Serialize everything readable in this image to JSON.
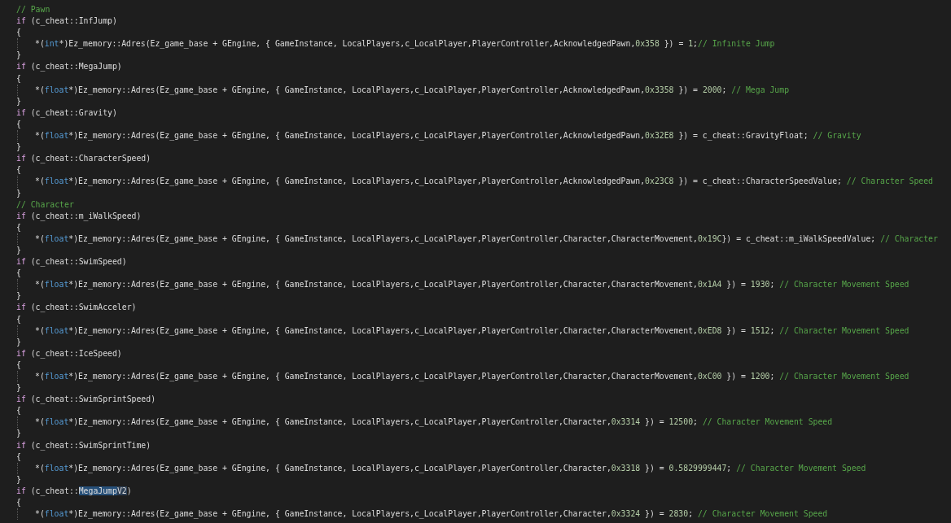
{
  "editor": {
    "lines": [
      {
        "kind": "comment",
        "tokens": [
          {
            "text": "// Pawn",
            "kind": "comment"
          }
        ]
      },
      {
        "kind": "if",
        "tokens": [
          {
            "text": "if",
            "kind": "control"
          },
          {
            "text": " (c_cheat::InfJump)",
            "kind": "plain"
          }
        ]
      },
      {
        "kind": "brace",
        "tokens": [
          {
            "text": "{",
            "kind": "plain"
          }
        ]
      },
      {
        "kind": "statement",
        "tokens": [
          {
            "text": "*(",
            "kind": "plain"
          },
          {
            "text": "int",
            "kind": "keyword"
          },
          {
            "text": "*)Ez_memory::Adres(Ez_game_base + GEngine, { GameInstance, LocalPlayers,c_LocalPlayer,PlayerController,AcknowledgedPawn,",
            "kind": "plain"
          },
          {
            "text": "0x358",
            "kind": "number"
          },
          {
            "text": " }) = ",
            "kind": "plain"
          },
          {
            "text": "1",
            "kind": "number"
          },
          {
            "text": ";",
            "kind": "plain"
          },
          {
            "text": "// Infınite Jump",
            "kind": "comment"
          }
        ]
      },
      {
        "kind": "brace",
        "tokens": [
          {
            "text": "}",
            "kind": "plain"
          }
        ]
      },
      {
        "kind": "if",
        "tokens": [
          {
            "text": "if",
            "kind": "control"
          },
          {
            "text": " (c_cheat::MegaJump)",
            "kind": "plain"
          }
        ]
      },
      {
        "kind": "brace",
        "tokens": [
          {
            "text": "{",
            "kind": "plain"
          }
        ]
      },
      {
        "kind": "statement",
        "tokens": [
          {
            "text": "*(",
            "kind": "plain"
          },
          {
            "text": "float",
            "kind": "keyword"
          },
          {
            "text": "*)Ez_memory::Adres(Ez_game_base + GEngine, { GameInstance, LocalPlayers,c_LocalPlayer,PlayerController,AcknowledgedPawn,",
            "kind": "plain"
          },
          {
            "text": "0x3358",
            "kind": "number"
          },
          {
            "text": " }) = ",
            "kind": "plain"
          },
          {
            "text": "2000",
            "kind": "number"
          },
          {
            "text": "; ",
            "kind": "plain"
          },
          {
            "text": "// Mega Jump",
            "kind": "comment"
          }
        ]
      },
      {
        "kind": "brace",
        "tokens": [
          {
            "text": "}",
            "kind": "plain"
          }
        ]
      },
      {
        "kind": "if",
        "tokens": [
          {
            "text": "if",
            "kind": "control"
          },
          {
            "text": " (c_cheat::Gravity)",
            "kind": "plain"
          }
        ]
      },
      {
        "kind": "brace",
        "tokens": [
          {
            "text": "{",
            "kind": "plain"
          }
        ]
      },
      {
        "kind": "statement",
        "tokens": [
          {
            "text": "*(",
            "kind": "plain"
          },
          {
            "text": "float",
            "kind": "keyword"
          },
          {
            "text": "*)Ez_memory::Adres(Ez_game_base + GEngine, { GameInstance, LocalPlayers,c_LocalPlayer,PlayerController,AcknowledgedPawn,",
            "kind": "plain"
          },
          {
            "text": "0x32E8",
            "kind": "number"
          },
          {
            "text": " }) = c_cheat::GravityFloat; ",
            "kind": "plain"
          },
          {
            "text": "// Gravity",
            "kind": "comment"
          }
        ]
      },
      {
        "kind": "brace",
        "tokens": [
          {
            "text": "}",
            "kind": "plain"
          }
        ]
      },
      {
        "kind": "if",
        "tokens": [
          {
            "text": "if",
            "kind": "control"
          },
          {
            "text": " (c_cheat::CharacterSpeed)",
            "kind": "plain"
          }
        ]
      },
      {
        "kind": "brace",
        "tokens": [
          {
            "text": "{",
            "kind": "plain"
          }
        ]
      },
      {
        "kind": "statement",
        "tokens": [
          {
            "text": "*(",
            "kind": "plain"
          },
          {
            "text": "float",
            "kind": "keyword"
          },
          {
            "text": "*)Ez_memory::Adres(Ez_game_base + GEngine, { GameInstance, LocalPlayers,c_LocalPlayer,PlayerController,AcknowledgedPawn,",
            "kind": "plain"
          },
          {
            "text": "0x23C8",
            "kind": "number"
          },
          {
            "text": " }) = c_cheat::CharacterSpeedValue; ",
            "kind": "plain"
          },
          {
            "text": "// Character Speed",
            "kind": "comment"
          }
        ]
      },
      {
        "kind": "brace",
        "tokens": [
          {
            "text": "}",
            "kind": "plain"
          }
        ]
      },
      {
        "kind": "comment",
        "tokens": [
          {
            "text": "// Character",
            "kind": "comment"
          }
        ]
      },
      {
        "kind": "if",
        "tokens": [
          {
            "text": "if",
            "kind": "control"
          },
          {
            "text": " (c_cheat::m_iWalkSpeed)",
            "kind": "plain"
          }
        ]
      },
      {
        "kind": "brace",
        "tokens": [
          {
            "text": "{",
            "kind": "plain"
          }
        ]
      },
      {
        "kind": "statement",
        "tokens": [
          {
            "text": "*(",
            "kind": "plain"
          },
          {
            "text": "float",
            "kind": "keyword"
          },
          {
            "text": "*)Ez_memory::Adres(Ez_game_base + GEngine, { GameInstance, LocalPlayers,c_LocalPlayer,PlayerController,Character,CharacterMovement,",
            "kind": "plain"
          },
          {
            "text": "0x19C",
            "kind": "number"
          },
          {
            "text": "}) = c_cheat::m_iWalkSpeedValue; ",
            "kind": "plain"
          },
          {
            "text": "// Character",
            "kind": "comment"
          }
        ]
      },
      {
        "kind": "brace",
        "tokens": [
          {
            "text": "}",
            "kind": "plain"
          }
        ]
      },
      {
        "kind": "if",
        "tokens": [
          {
            "text": "if",
            "kind": "control"
          },
          {
            "text": " (c_cheat::SwimSpeed)",
            "kind": "plain"
          }
        ]
      },
      {
        "kind": "brace",
        "tokens": [
          {
            "text": "{",
            "kind": "plain"
          }
        ]
      },
      {
        "kind": "statement",
        "tokens": [
          {
            "text": "*(",
            "kind": "plain"
          },
          {
            "text": "float",
            "kind": "keyword"
          },
          {
            "text": "*)Ez_memory::Adres(Ez_game_base + GEngine, { GameInstance, LocalPlayers,c_LocalPlayer,PlayerController,Character,CharacterMovement,",
            "kind": "plain"
          },
          {
            "text": "0x1A4",
            "kind": "number"
          },
          {
            "text": " }) = ",
            "kind": "plain"
          },
          {
            "text": "1930",
            "kind": "number"
          },
          {
            "text": "; ",
            "kind": "plain"
          },
          {
            "text": "// Character Movement Speed",
            "kind": "comment"
          }
        ]
      },
      {
        "kind": "brace",
        "tokens": [
          {
            "text": "}",
            "kind": "plain"
          }
        ]
      },
      {
        "kind": "if",
        "tokens": [
          {
            "text": "if",
            "kind": "control"
          },
          {
            "text": " (c_cheat::SwimAcceler)",
            "kind": "plain"
          }
        ]
      },
      {
        "kind": "brace",
        "tokens": [
          {
            "text": "{",
            "kind": "plain"
          }
        ]
      },
      {
        "kind": "statement",
        "tokens": [
          {
            "text": "*(",
            "kind": "plain"
          },
          {
            "text": "float",
            "kind": "keyword"
          },
          {
            "text": "*)Ez_memory::Adres(Ez_game_base + GEngine, { GameInstance, LocalPlayers,c_LocalPlayer,PlayerController,Character,CharacterMovement,",
            "kind": "plain"
          },
          {
            "text": "0xED8",
            "kind": "number"
          },
          {
            "text": " }) = ",
            "kind": "plain"
          },
          {
            "text": "1512",
            "kind": "number"
          },
          {
            "text": "; ",
            "kind": "plain"
          },
          {
            "text": "// Character Movement Speed",
            "kind": "comment"
          }
        ]
      },
      {
        "kind": "brace",
        "tokens": [
          {
            "text": "}",
            "kind": "plain"
          }
        ]
      },
      {
        "kind": "if",
        "tokens": [
          {
            "text": "if",
            "kind": "control"
          },
          {
            "text": " (c_cheat::IceSpeed)",
            "kind": "plain"
          }
        ]
      },
      {
        "kind": "brace",
        "tokens": [
          {
            "text": "{",
            "kind": "plain"
          }
        ]
      },
      {
        "kind": "statement",
        "tokens": [
          {
            "text": "*(",
            "kind": "plain"
          },
          {
            "text": "float",
            "kind": "keyword"
          },
          {
            "text": "*)Ez_memory::Adres(Ez_game_base + GEngine, { GameInstance, LocalPlayers,c_LocalPlayer,PlayerController,Character,CharacterMovement,",
            "kind": "plain"
          },
          {
            "text": "0xC00",
            "kind": "number"
          },
          {
            "text": " }) = ",
            "kind": "plain"
          },
          {
            "text": "1200",
            "kind": "number"
          },
          {
            "text": "; ",
            "kind": "plain"
          },
          {
            "text": "// Character Movement Speed",
            "kind": "comment"
          }
        ]
      },
      {
        "kind": "brace",
        "tokens": [
          {
            "text": "}",
            "kind": "plain"
          }
        ]
      },
      {
        "kind": "if",
        "tokens": [
          {
            "text": "if",
            "kind": "control"
          },
          {
            "text": " (c_cheat::SwimSprintSpeed)",
            "kind": "plain"
          }
        ]
      },
      {
        "kind": "brace",
        "tokens": [
          {
            "text": "{",
            "kind": "plain"
          }
        ]
      },
      {
        "kind": "statement",
        "tokens": [
          {
            "text": "*(",
            "kind": "plain"
          },
          {
            "text": "float",
            "kind": "keyword"
          },
          {
            "text": "*)Ez_memory::Adres(Ez_game_base + GEngine, { GameInstance, LocalPlayers,c_LocalPlayer,PlayerController,Character,",
            "kind": "plain"
          },
          {
            "text": "0x3314",
            "kind": "number"
          },
          {
            "text": " }) = ",
            "kind": "plain"
          },
          {
            "text": "12500",
            "kind": "number"
          },
          {
            "text": "; ",
            "kind": "plain"
          },
          {
            "text": "// Character Movement Speed",
            "kind": "comment"
          }
        ]
      },
      {
        "kind": "brace",
        "tokens": [
          {
            "text": "}",
            "kind": "plain"
          }
        ]
      },
      {
        "kind": "if",
        "tokens": [
          {
            "text": "if",
            "kind": "control"
          },
          {
            "text": " (c_cheat::SwimSprintTime)",
            "kind": "plain"
          }
        ]
      },
      {
        "kind": "brace",
        "tokens": [
          {
            "text": "{",
            "kind": "plain"
          }
        ]
      },
      {
        "kind": "statement",
        "tokens": [
          {
            "text": "*(",
            "kind": "plain"
          },
          {
            "text": "float",
            "kind": "keyword"
          },
          {
            "text": "*)Ez_memory::Adres(Ez_game_base + GEngine, { GameInstance, LocalPlayers,c_LocalPlayer,PlayerController,Character,",
            "kind": "plain"
          },
          {
            "text": "0x3318",
            "kind": "number"
          },
          {
            "text": " }) = ",
            "kind": "plain"
          },
          {
            "text": "0.5829999447",
            "kind": "number"
          },
          {
            "text": "; ",
            "kind": "plain"
          },
          {
            "text": "// Character Movement Speed",
            "kind": "comment"
          }
        ]
      },
      {
        "kind": "brace",
        "tokens": [
          {
            "text": "}",
            "kind": "plain"
          }
        ]
      },
      {
        "kind": "if",
        "tokens": [
          {
            "text": "if",
            "kind": "control"
          },
          {
            "text": " (c_cheat::",
            "kind": "plain"
          },
          {
            "text": "MegaJump",
            "kind": "plain",
            "selected": true
          },
          {
            "text": "V2",
            "kind": "plain",
            "matched": true
          },
          {
            "text": ")",
            "kind": "plain"
          }
        ]
      },
      {
        "kind": "brace",
        "tokens": [
          {
            "text": "{",
            "kind": "plain"
          }
        ]
      },
      {
        "kind": "statement",
        "tokens": [
          {
            "text": "*(",
            "kind": "plain"
          },
          {
            "text": "float",
            "kind": "keyword"
          },
          {
            "text": "*)Ez_memory::Adres(Ez_game_base + GEngine, { GameInstance, LocalPlayers,c_LocalPlayer,PlayerController,Character,",
            "kind": "plain"
          },
          {
            "text": "0x3324",
            "kind": "number"
          },
          {
            "text": " }) = ",
            "kind": "plain"
          },
          {
            "text": "2830",
            "kind": "number"
          },
          {
            "text": "; ",
            "kind": "plain"
          },
          {
            "text": "// Character Movement Speed",
            "kind": "comment"
          }
        ]
      }
    ]
  }
}
